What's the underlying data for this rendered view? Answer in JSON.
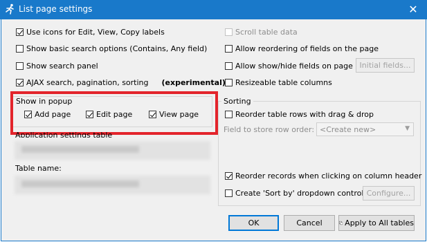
{
  "window": {
    "title": "List page settings",
    "close_glyph": "✕"
  },
  "left": {
    "use_icons": {
      "label": "Use icons for Edit, View, Copy labels",
      "checked": true
    },
    "basic_search": {
      "label": "Show basic search options (Contains, Any field)",
      "checked": false
    },
    "search_panel": {
      "label": "Show search panel",
      "checked": false
    },
    "ajax": {
      "label": "AJAX search, pagination, sorting",
      "checked": true,
      "note": "(experimental)"
    }
  },
  "popup": {
    "title": "Show in popup",
    "add_page": {
      "label": "Add page",
      "checked": true
    },
    "edit_page": {
      "label": "Edit page",
      "checked": true
    },
    "view_page": {
      "label": "View page",
      "checked": true
    }
  },
  "settings": {
    "app_table_label": "Application settings table",
    "table_name_label": "Table name:"
  },
  "right": {
    "scroll_table": {
      "label": "Scroll table data",
      "checked": false,
      "disabled": true
    },
    "reorder_fields": {
      "label": "Allow reordering of fields on the page",
      "checked": false
    },
    "show_hide_fields": {
      "label": "Allow show/hide fields on page",
      "checked": false
    },
    "initial_fields_button": "Initial fields...",
    "resizeable_columns": {
      "label": "Resizeable table columns",
      "checked": false
    }
  },
  "sorting": {
    "title": "Sorting",
    "drag_drop": {
      "label": "Reorder table rows with drag & drop",
      "checked": false
    },
    "field_label": "Field to store row order:",
    "field_value": "<Create new>",
    "reorder_header": {
      "label": "Reorder records when clicking on column header",
      "checked": true
    },
    "sort_by_dropdown": {
      "label": "Create 'Sort by' dropdown control",
      "checked": false
    },
    "configure_button": "Configure..."
  },
  "buttons": {
    "ok": "OK",
    "cancel": "Cancel",
    "apply_all": "Apply to All tables"
  },
  "colors": {
    "titlebar": "#1979ca",
    "highlight": "#e3242b"
  }
}
